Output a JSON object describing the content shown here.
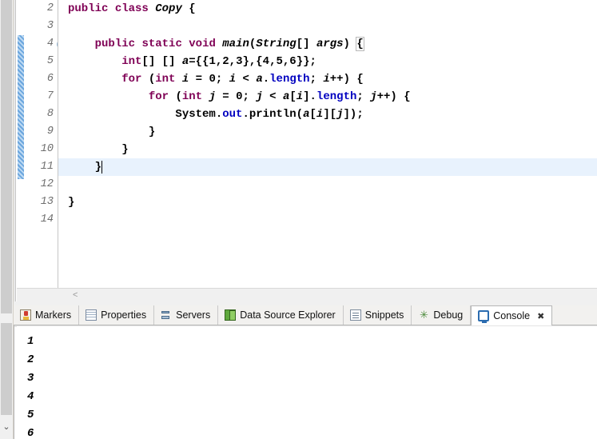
{
  "app": {
    "name": "Eclipse IDE",
    "accent_color": "#2b6cb0",
    "keyword_color": "#7f0055",
    "field_color": "#0000c0",
    "current_line_color": "#e8f2fd",
    "fold_bar_color": "#6ba6de"
  },
  "editor": {
    "first_visible_line": 2,
    "current_line": 11,
    "fold_marker_line": 4,
    "horizontal_scroll_glyph": "<",
    "lines": [
      {
        "number": 2,
        "tokens": [
          {
            "t": "public",
            "c": "kw"
          },
          {
            "t": " ",
            "c": "plain"
          },
          {
            "t": "class",
            "c": "kw"
          },
          {
            "t": " ",
            "c": "plain"
          },
          {
            "t": "Copy",
            "c": "plain ital"
          },
          {
            "t": " {",
            "c": "plain"
          }
        ]
      },
      {
        "number": 3,
        "tokens": []
      },
      {
        "number": 4,
        "tokens": [
          {
            "t": "    ",
            "c": "plain"
          },
          {
            "t": "public",
            "c": "kw"
          },
          {
            "t": " ",
            "c": "plain"
          },
          {
            "t": "static",
            "c": "kw"
          },
          {
            "t": " ",
            "c": "plain"
          },
          {
            "t": "void",
            "c": "kw"
          },
          {
            "t": " ",
            "c": "plain"
          },
          {
            "t": "main",
            "c": "plain ital"
          },
          {
            "t": "(",
            "c": "plain"
          },
          {
            "t": "String",
            "c": "plain ital"
          },
          {
            "t": "[] ",
            "c": "plain"
          },
          {
            "t": "args",
            "c": "plain ital"
          },
          {
            "t": ") ",
            "c": "plain"
          },
          {
            "t": "{",
            "c": "plain br-box"
          }
        ]
      },
      {
        "number": 5,
        "tokens": [
          {
            "t": "        ",
            "c": "plain"
          },
          {
            "t": "int",
            "c": "kw"
          },
          {
            "t": "[] [] ",
            "c": "plain"
          },
          {
            "t": "a",
            "c": "plain ital"
          },
          {
            "t": "={{1,2,3},{4,5,6}};",
            "c": "plain"
          }
        ]
      },
      {
        "number": 6,
        "tokens": [
          {
            "t": "        ",
            "c": "plain"
          },
          {
            "t": "for",
            "c": "kw"
          },
          {
            "t": " (",
            "c": "plain"
          },
          {
            "t": "int",
            "c": "kw"
          },
          {
            "t": " ",
            "c": "plain"
          },
          {
            "t": "i",
            "c": "plain ital"
          },
          {
            "t": " = 0; ",
            "c": "plain"
          },
          {
            "t": "i",
            "c": "plain ital"
          },
          {
            "t": " < ",
            "c": "plain"
          },
          {
            "t": "a",
            "c": "plain ital"
          },
          {
            "t": ".",
            "c": "plain"
          },
          {
            "t": "length",
            "c": "fld"
          },
          {
            "t": "; ",
            "c": "plain"
          },
          {
            "t": "i",
            "c": "plain ital"
          },
          {
            "t": "++) {",
            "c": "plain"
          }
        ]
      },
      {
        "number": 7,
        "tokens": [
          {
            "t": "            ",
            "c": "plain"
          },
          {
            "t": "for",
            "c": "kw"
          },
          {
            "t": " (",
            "c": "plain"
          },
          {
            "t": "int",
            "c": "kw"
          },
          {
            "t": " ",
            "c": "plain"
          },
          {
            "t": "j",
            "c": "plain ital"
          },
          {
            "t": " = 0; ",
            "c": "plain"
          },
          {
            "t": "j",
            "c": "plain ital"
          },
          {
            "t": " < ",
            "c": "plain"
          },
          {
            "t": "a",
            "c": "plain ital"
          },
          {
            "t": "[",
            "c": "plain"
          },
          {
            "t": "i",
            "c": "plain ital"
          },
          {
            "t": "].",
            "c": "plain"
          },
          {
            "t": "length",
            "c": "fld"
          },
          {
            "t": "; ",
            "c": "plain"
          },
          {
            "t": "j",
            "c": "plain ital"
          },
          {
            "t": "++) {",
            "c": "plain"
          }
        ]
      },
      {
        "number": 8,
        "tokens": [
          {
            "t": "                ",
            "c": "plain"
          },
          {
            "t": "System",
            "c": "plain"
          },
          {
            "t": ".",
            "c": "plain"
          },
          {
            "t": "out",
            "c": "fld"
          },
          {
            "t": ".println(",
            "c": "plain"
          },
          {
            "t": "a",
            "c": "plain ital"
          },
          {
            "t": "[",
            "c": "plain"
          },
          {
            "t": "i",
            "c": "plain ital"
          },
          {
            "t": "][",
            "c": "plain"
          },
          {
            "t": "j",
            "c": "plain ital"
          },
          {
            "t": "]);",
            "c": "plain"
          }
        ]
      },
      {
        "number": 9,
        "tokens": [
          {
            "t": "            }",
            "c": "plain"
          }
        ]
      },
      {
        "number": 10,
        "tokens": [
          {
            "t": "        }",
            "c": "plain"
          }
        ]
      },
      {
        "number": 11,
        "tokens": [
          {
            "t": "    }",
            "c": "plain"
          }
        ]
      },
      {
        "number": 12,
        "tokens": []
      },
      {
        "number": 13,
        "tokens": [
          {
            "t": "}",
            "c": "plain"
          }
        ]
      },
      {
        "number": 14,
        "tokens": []
      }
    ]
  },
  "bottom_panel": {
    "active_tab": "Console",
    "tabs": [
      {
        "label": "Markers",
        "icon": "markers-icon",
        "active": false,
        "closable": false
      },
      {
        "label": "Properties",
        "icon": "properties-icon",
        "active": false,
        "closable": false
      },
      {
        "label": "Servers",
        "icon": "servers-icon",
        "active": false,
        "closable": false
      },
      {
        "label": "Data Source Explorer",
        "icon": "data-source-explorer-icon",
        "active": false,
        "closable": false
      },
      {
        "label": "Snippets",
        "icon": "snippets-icon",
        "active": false,
        "closable": false
      },
      {
        "label": "Debug",
        "icon": "debug-icon",
        "active": false,
        "closable": false
      },
      {
        "label": "Console",
        "icon": "console-icon",
        "active": true,
        "closable": true
      }
    ],
    "close_glyph": "✖",
    "console_output": [
      "1",
      "2",
      "3",
      "4",
      "5",
      "6"
    ]
  },
  "scrollbars": {
    "left_rail_down_arrow": "⌄"
  }
}
